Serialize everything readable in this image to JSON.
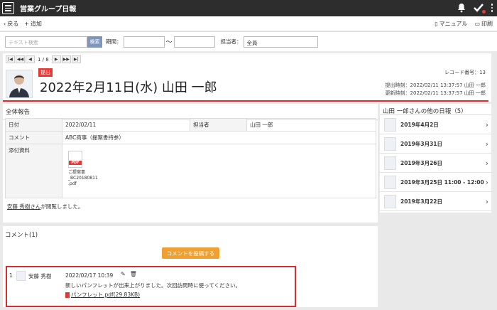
{
  "app": {
    "title": "営業グループ日報"
  },
  "toolbar": {
    "back": "戻る",
    "add": "追加",
    "manual": "マニュアル",
    "print": "印刷"
  },
  "search": {
    "placeholder": "テキスト検索",
    "button": "検索",
    "period_label": "期間：",
    "tilde": "〜",
    "assignee_label": "担当者：",
    "assignee_value": "全員"
  },
  "pager": {
    "first": "|◀",
    "prev_fast": "◀◀",
    "prev": "◀",
    "position": "1 / 8",
    "next": "▶",
    "next_fast": "▶▶",
    "last": "▶|"
  },
  "record": {
    "badge": "提出",
    "title": "2022年2月11日(水) 山田 一郎",
    "record_no": "レコード番号：13",
    "submitted": "提出時刻：2022/02/11 13:37:57 山田 一郎",
    "updated": "更新時刻：2022/02/11 13:37:57 山田 一郎"
  },
  "report": {
    "section_title": "全体報告",
    "date_label": "日付",
    "date_value": "2022/02/11",
    "assignee_label": "担当者",
    "assignee_value": "山田 一郎",
    "comment_label": "コメント",
    "comment_value": "ABC商事（提案書持参）",
    "attach_label": "添付資料",
    "file_badge": "PDF",
    "file_name_1": "ご提案書",
    "file_name_2": "_BC20180811",
    "file_name_3": ".pdf",
    "viewer_name": "安藤 秀樹さん",
    "viewed_text": "が閲覧しました。"
  },
  "side": {
    "title": "山田 一郎さんの他の日報（5）",
    "items": [
      {
        "date": "2019年4月2日"
      },
      {
        "date": "2019年3月31日"
      },
      {
        "date": "2019年3月26日"
      },
      {
        "date": "2019年3月25日 11:00 - 12:00"
      },
      {
        "date": "2019年3月22日"
      }
    ]
  },
  "comments": {
    "title": "コメント(1)",
    "post_button": "コメントを投稿する",
    "item": {
      "number": "1",
      "author": "安藤 秀樹",
      "datetime": "2022/02/17 10:39",
      "text": "新しいパンフレットが出来上がりました。次回訪問時に使ってください。",
      "file": "パンフレット.pdf(29.83KB)"
    }
  }
}
